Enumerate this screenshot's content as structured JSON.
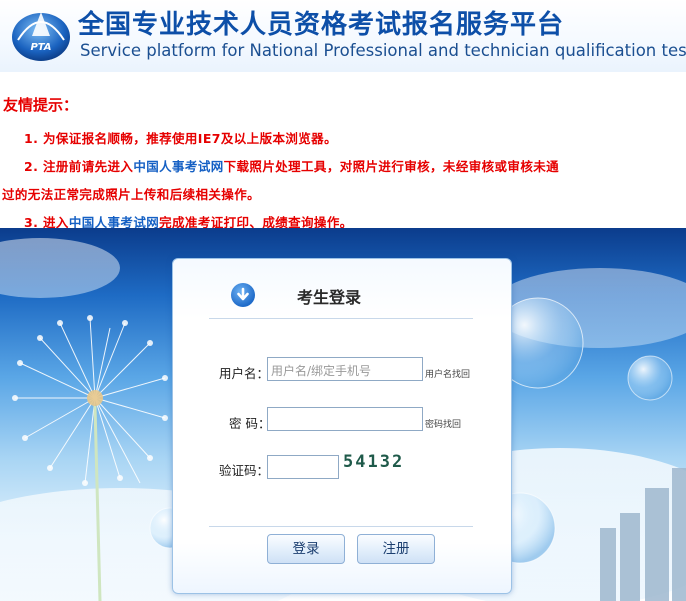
{
  "header": {
    "logo_text": "PTA",
    "title_cn": "全国专业技术人员资格考试报名服务平台",
    "title_en": "Service platform for National Professional and technician qualification test"
  },
  "notice": {
    "title": "友情提示：",
    "tip1": "1. 为保证报名顺畅，推荐使用IE7及以上版本浏览器。",
    "tip2_a": "2. 注册前请先进入",
    "tip2_link": "中国人事考试网",
    "tip2_b": "下载照片处理工具，对照片进行审核，未经审核或审核未通",
    "tip2_c": "过的无法正常完成照片上传和后续相关操作。",
    "tip3_a": "3. 进入",
    "tip3_link": "中国人事考试网",
    "tip3_b": "完成准考证打印、成绩查询操作。"
  },
  "login": {
    "title": "考生登录",
    "username_label": "用户名：",
    "username_placeholder": "用户名/绑定手机号",
    "username_help": "用户名找回",
    "password_label": "密 码：",
    "password_help": "密码找回",
    "captcha_label": "验证码：",
    "captcha_value": "54132",
    "login_button": "登录",
    "register_button": "注册"
  },
  "colors": {
    "brand_blue": "#0d4fa8",
    "notice_red": "#e60000",
    "link_blue": "#1560c4"
  },
  "icons": [
    "pta-logo-icon",
    "arrow-down-circle-icon"
  ]
}
